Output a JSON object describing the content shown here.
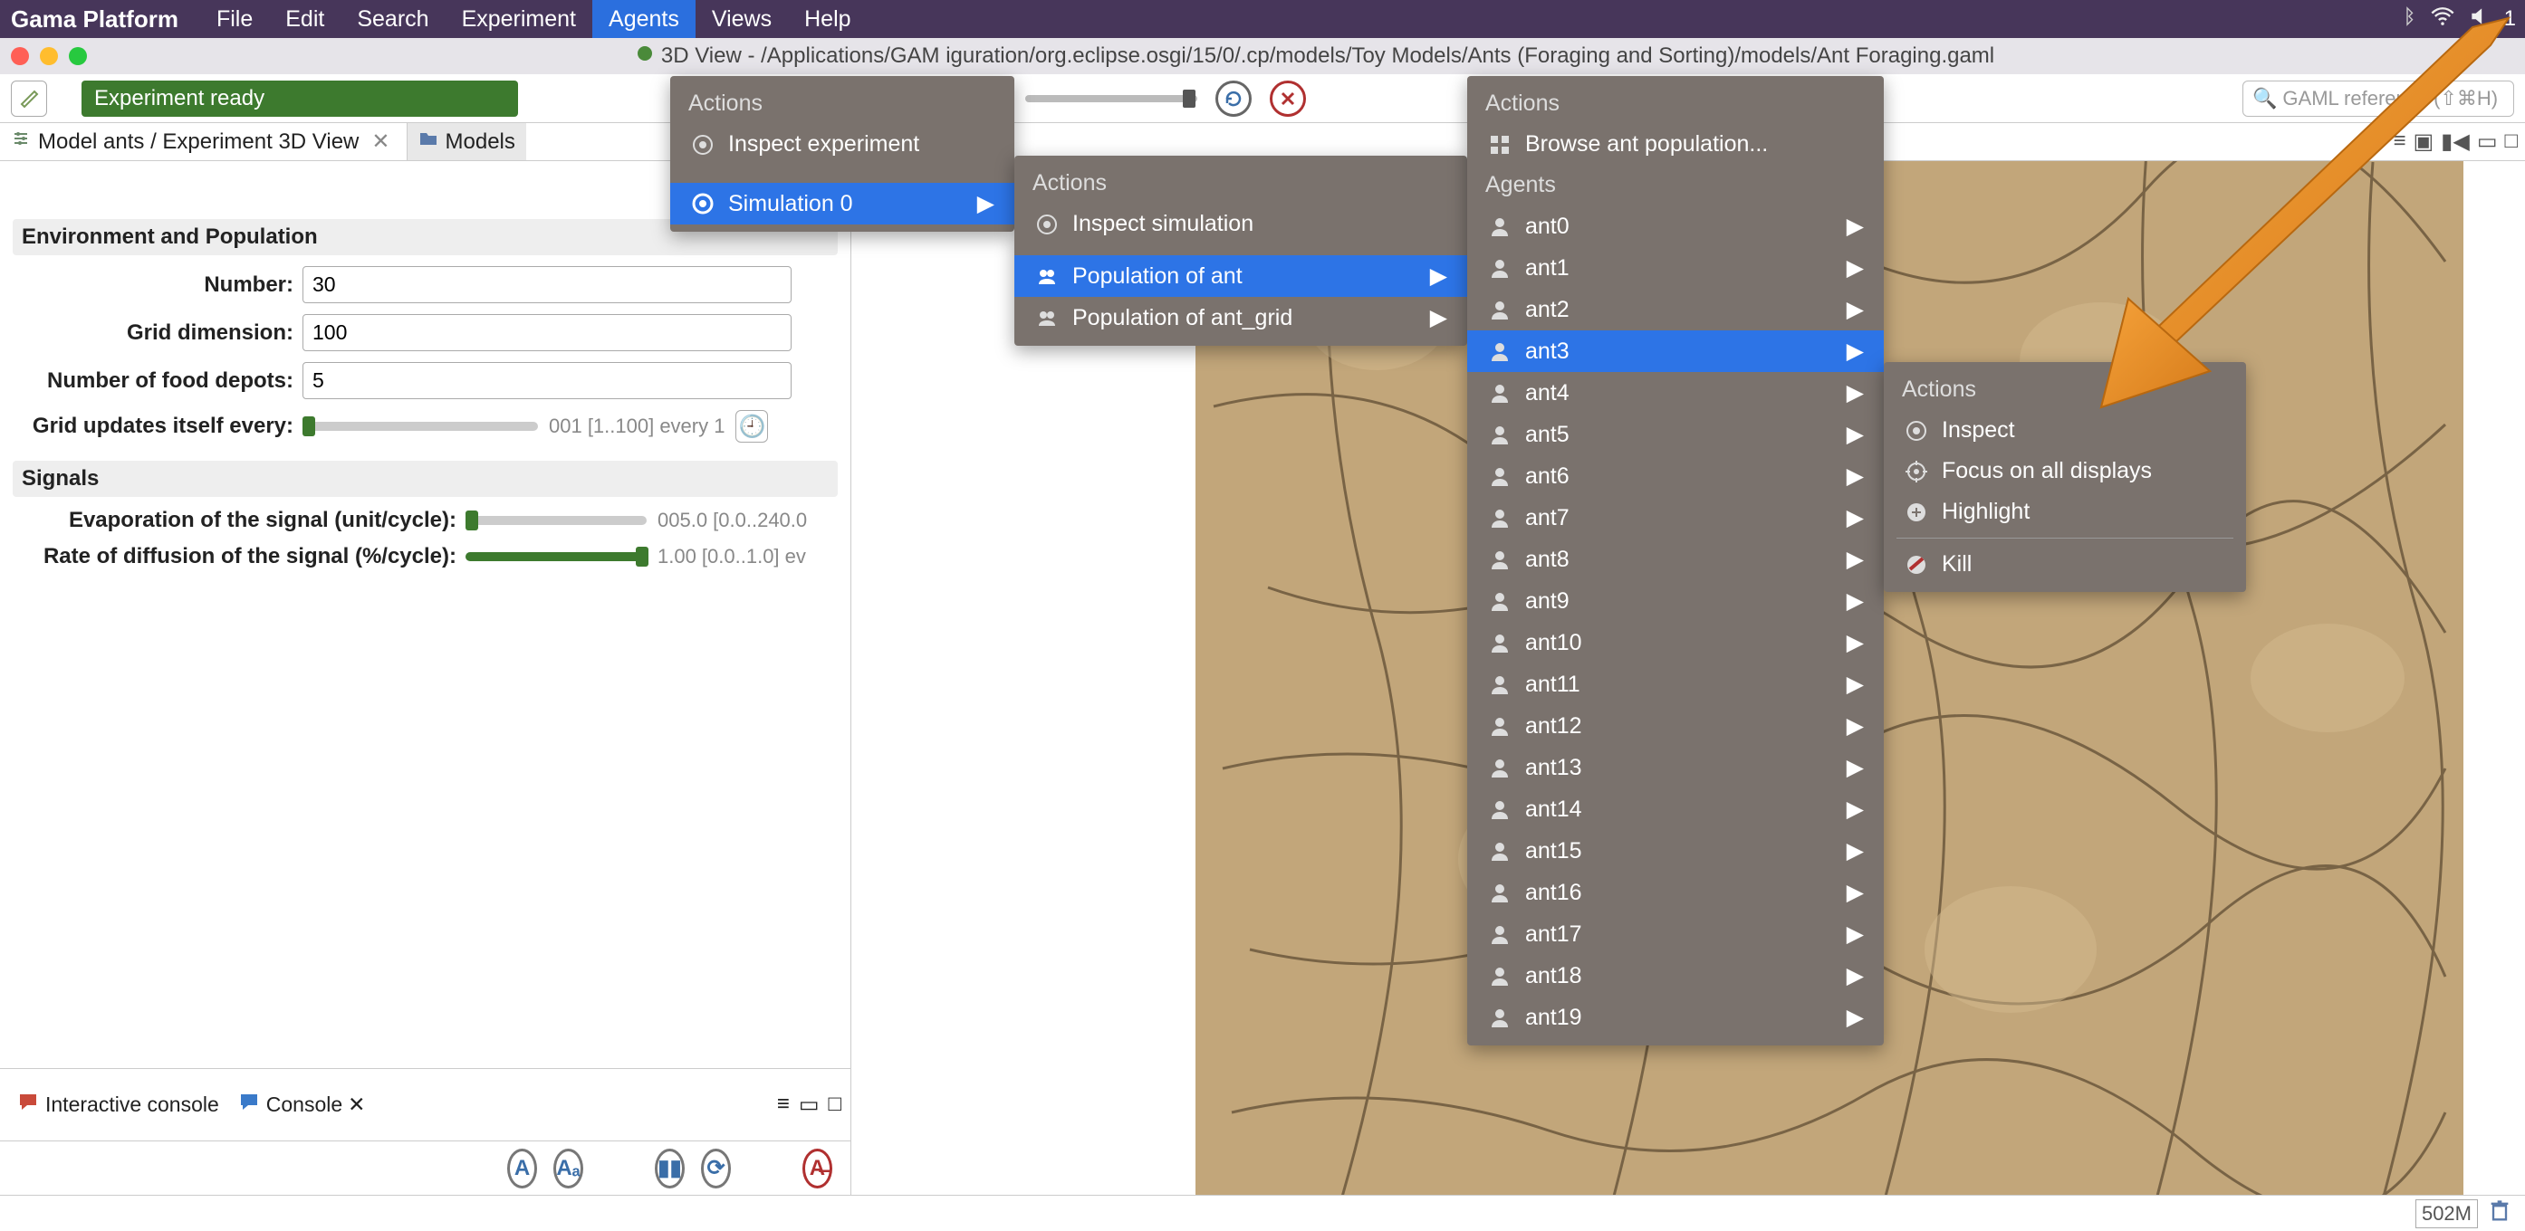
{
  "app_name": "Gama Platform",
  "menubar": {
    "items": [
      "File",
      "Edit",
      "Search",
      "Experiment",
      "Agents",
      "Views",
      "Help"
    ],
    "active_index": 4
  },
  "window_title": "3D View - /Applications/GAM          iguration/org.eclipse.osgi/15/0/.cp/models/Toy Models/Ants (Foraging and Sorting)/models/Ant Foraging.gaml",
  "experiment_status": "Experiment ready",
  "search_placeholder": "GAML reference (⇧⌘H)",
  "breadcrumb": "Model ants / Experiment 3D View",
  "folder_tab": "Models",
  "params": {
    "section1": "Environment and Population",
    "number_label": "Number:",
    "number_value": "30",
    "grid_dim_label": "Grid dimension:",
    "grid_dim_value": "100",
    "food_depots_label": "Number of food depots:",
    "food_depots_value": "5",
    "grid_updates_label": "Grid updates itself every:",
    "grid_updates_hint": "001 [1..100] every 1",
    "section2": "Signals",
    "evap_label": "Evaporation of the signal (unit/cycle):",
    "evap_hint": "005.0 [0.0..240.0",
    "diff_label": "Rate of diffusion of the signal (%/cycle):",
    "diff_hint": "1.00 [0.0..1.0] ev"
  },
  "consoles": {
    "interactive": "Interactive console",
    "console": "Console"
  },
  "status": {
    "memory": "502M"
  },
  "menu1": {
    "actions_hdr": "Actions",
    "inspect": "Inspect experiment",
    "sim0": "Simulation 0"
  },
  "menu2": {
    "actions_hdr": "Actions",
    "inspect": "Inspect simulation",
    "pop_ant": "Population of ant",
    "pop_grid": "Population of ant_grid"
  },
  "menu3": {
    "actions_hdr": "Actions",
    "browse": "Browse ant population...",
    "agents_hdr": "Agents",
    "agents": [
      "ant0",
      "ant1",
      "ant2",
      "ant3",
      "ant4",
      "ant5",
      "ant6",
      "ant7",
      "ant8",
      "ant9",
      "ant10",
      "ant11",
      "ant12",
      "ant13",
      "ant14",
      "ant15",
      "ant16",
      "ant17",
      "ant18",
      "ant19"
    ],
    "selected_index": 3
  },
  "menu4": {
    "actions_hdr": "Actions",
    "inspect": "Inspect",
    "focus": "Focus on all displays",
    "highlight": "Highlight",
    "kill": "Kill"
  }
}
